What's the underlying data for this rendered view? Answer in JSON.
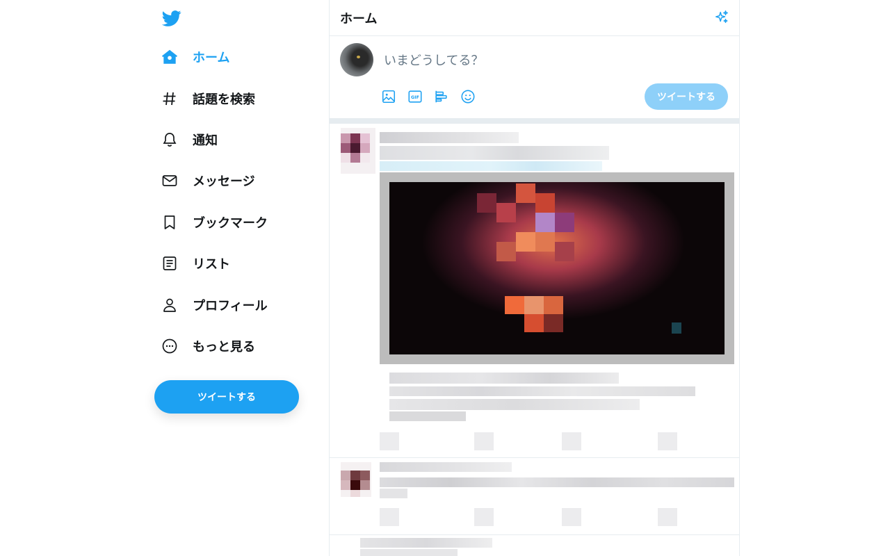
{
  "nav": {
    "items": [
      {
        "key": "home",
        "label": "ホーム",
        "icon": "home-icon",
        "active": true
      },
      {
        "key": "explore",
        "label": "話題を検索",
        "icon": "hashtag-icon",
        "active": false
      },
      {
        "key": "notifications",
        "label": "通知",
        "icon": "bell-icon",
        "active": false
      },
      {
        "key": "messages",
        "label": "メッセージ",
        "icon": "envelope-icon",
        "active": false
      },
      {
        "key": "bookmarks",
        "label": "ブックマーク",
        "icon": "bookmark-icon",
        "active": false
      },
      {
        "key": "lists",
        "label": "リスト",
        "icon": "list-icon",
        "active": false
      },
      {
        "key": "profile",
        "label": "プロフィール",
        "icon": "person-icon",
        "active": false
      },
      {
        "key": "more",
        "label": "もっと見る",
        "icon": "more-circle-icon",
        "active": false
      }
    ],
    "tweet_button": "ツイートする"
  },
  "header": {
    "title": "ホーム",
    "sparkle_icon": "sparkle-icon"
  },
  "composer": {
    "placeholder": "いまどうしてる？",
    "tools": [
      "image-icon",
      "gif-icon",
      "poll-icon",
      "emoji-icon"
    ],
    "tweet_button": "ツイートする"
  },
  "colors": {
    "accent": "#1da1f2",
    "accent_disabled": "#8ed0f9",
    "text": "#14171a",
    "muted": "#657786",
    "border": "#e6ecf0"
  }
}
